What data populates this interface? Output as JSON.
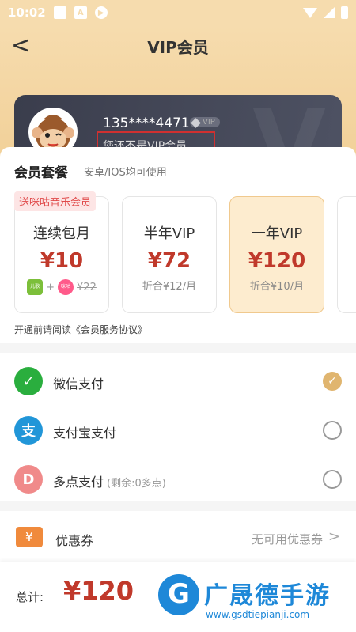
{
  "status_bar": {
    "time": "10:02"
  },
  "header": {
    "title": "VIP会员"
  },
  "user_card": {
    "phone": "135****4471",
    "vip_badge": "VIP",
    "status": "您还不是VIP会员"
  },
  "plans_section": {
    "title": "会员套餐",
    "subtitle": "安卓/IOS均可使用",
    "promo_tag": "送咪咕音乐会员",
    "plans": [
      {
        "name": "连续包月",
        "price": "¥10",
        "original_price": "¥22"
      },
      {
        "name": "半年VIP",
        "price": "¥72",
        "per_month": "折合¥12/月"
      },
      {
        "name": "一年VIP",
        "price": "¥120",
        "per_month": "折合¥10/月",
        "selected": true
      }
    ],
    "agreement": "开通前请阅读《会员服务协议》"
  },
  "payment": {
    "methods": [
      {
        "label": "微信支付",
        "icon": "wechat-pay-icon",
        "color": "#2aae3e",
        "selected": true
      },
      {
        "label": "支付宝支付",
        "icon": "alipay-icon",
        "color": "#2196d8",
        "selected": false
      },
      {
        "label": "多点支付",
        "note": "(剩余:0多点)",
        "icon": "duodian-icon",
        "color": "#f08a8a",
        "selected": false
      }
    ]
  },
  "coupon": {
    "label": "优惠券",
    "status": "无可用优惠券"
  },
  "footer": {
    "total_label": "总计:",
    "total_value": "¥120"
  },
  "watermark": {
    "brand": "广晟德手游",
    "url": "www.gsdtiepianji.com"
  }
}
